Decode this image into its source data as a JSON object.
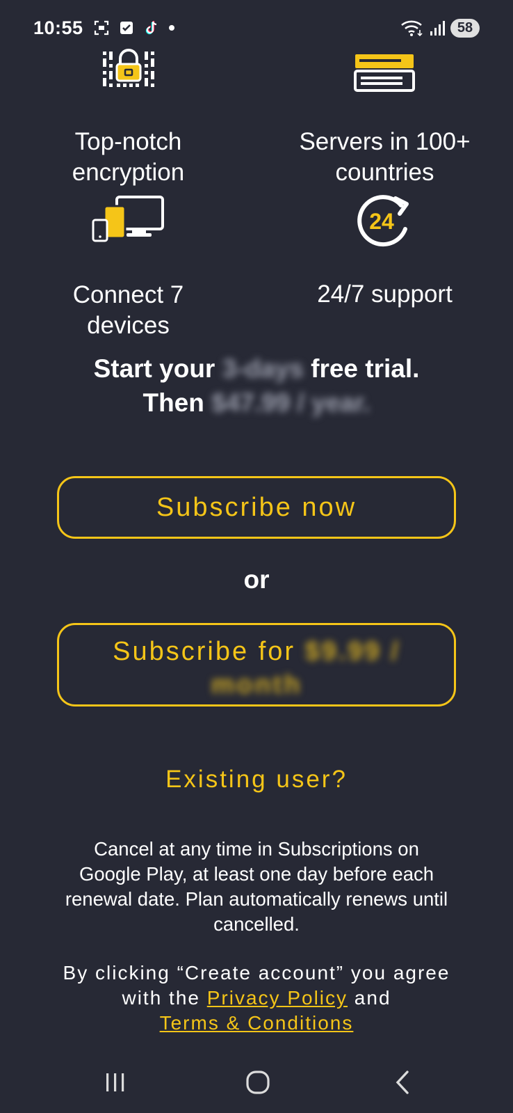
{
  "status_bar": {
    "time": "10:55",
    "battery": "58"
  },
  "features": [
    {
      "label_line1": "Top-notch",
      "label_line2": "encryption",
      "icon": "padlock-icon"
    },
    {
      "label_line1": "Servers in 100+",
      "label_line2": "countries",
      "icon": "server-icon"
    },
    {
      "label_line1": "Connect 7",
      "label_line2": "devices",
      "icon": "devices-icon"
    },
    {
      "label_line1": "24/7 support",
      "label_line2": "",
      "icon": "support-24-icon"
    }
  ],
  "trial": {
    "prefix": "Start your",
    "blurred_duration": "3-days",
    "suffix": "free trial.",
    "then": "Then",
    "blurred_price": "$47.99 / year."
  },
  "subscribe_now_label": "Subscribe now",
  "or_label": "or",
  "subscribe_for": {
    "label": "Subscribe for",
    "blurred_price": "$9.99 /",
    "blurred_period": "month"
  },
  "existing_user_label": "Existing user?",
  "cancel_note": "Cancel at any time in Subscriptions on Google Play, at least one day before each renewal date. Plan automatically renews until cancelled.",
  "legal": {
    "prefix": "By clicking “Create account” you agree with the",
    "privacy_link": "Privacy Policy",
    "and": "and",
    "terms_link": "Terms & Conditions"
  },
  "colors": {
    "background": "#272935",
    "accent": "#f5c518",
    "text": "#ffffff"
  }
}
